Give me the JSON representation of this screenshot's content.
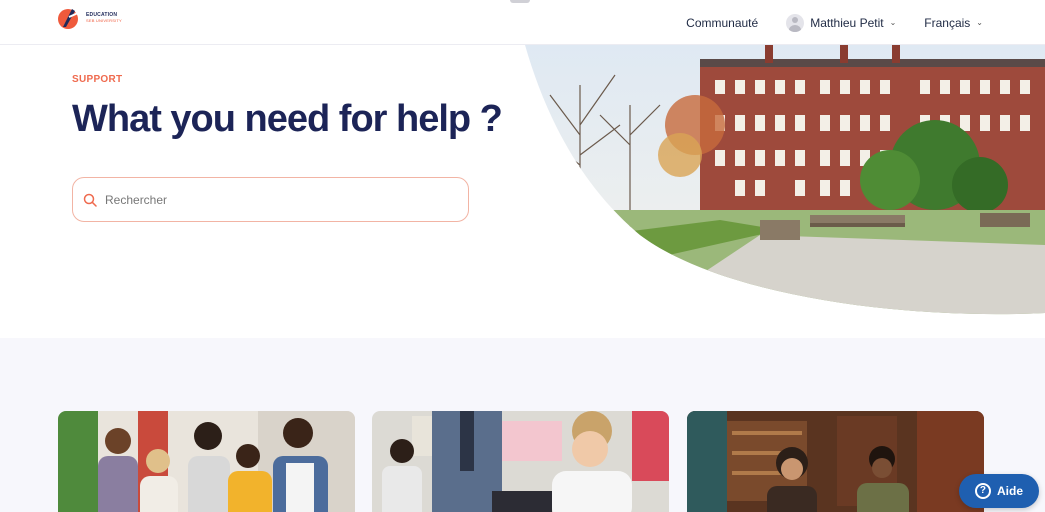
{
  "header": {
    "logo_line1": "EDUCATION",
    "logo_line2": "SEB UNIVERSITY",
    "nav": {
      "community": "Communauté",
      "user_name": "Matthieu Petit",
      "language": "Français"
    }
  },
  "hero": {
    "eyebrow": "SUPPORT",
    "title": "What you need for help ?",
    "search_placeholder": "Rechercher"
  },
  "cards": [
    {
      "image": "students-group-photo"
    },
    {
      "image": "student-studying-photo"
    },
    {
      "image": "library-students-photo"
    }
  ],
  "help_button": {
    "label": "Aide",
    "icon": "question-circle-icon"
  },
  "colors": {
    "accent": "#ef6a4e",
    "title": "#1c2457",
    "help_button": "#1f5fb0",
    "section_bg": "#f7f7fc"
  }
}
